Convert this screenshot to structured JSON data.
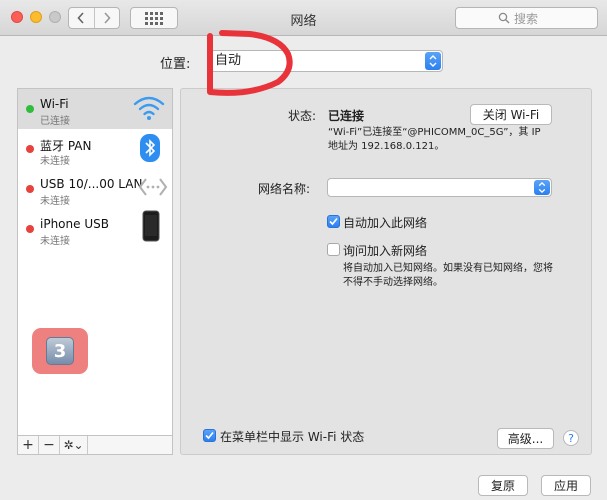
{
  "window": {
    "title": "网络",
    "search_placeholder": "搜索"
  },
  "location": {
    "label": "位置:",
    "value": "自动"
  },
  "sidebar": {
    "services": [
      {
        "name": "Wi-Fi",
        "status": "已连接",
        "dot": "green",
        "icon": "wifi-icon",
        "selected": true
      },
      {
        "name": "蓝牙 PAN",
        "status": "未连接",
        "dot": "red",
        "icon": "bluetooth-icon"
      },
      {
        "name": "USB 10/...00 LAN",
        "status": "未连接",
        "dot": "red",
        "icon": "ethernet-icon"
      },
      {
        "name": "iPhone USB",
        "status": "未连接",
        "dot": "red",
        "icon": "iphone-icon"
      }
    ],
    "tools": {
      "add": "+",
      "remove": "−",
      "gear": "✲⌄"
    }
  },
  "badge": {
    "number": "3"
  },
  "detail": {
    "status_label": "状态:",
    "status_value": "已连接",
    "turn_off_button": "关闭 Wi-Fi",
    "status_description": "“Wi-Fi”已连接至“@PHICOMM_0C_5G”，其 IP 地址为 192.168.0.121。",
    "network_name_label": "网络名称:",
    "network_name_value": "",
    "auto_join_label": "自动加入此网络",
    "auto_join_checked": true,
    "ask_join_label": "询问加入新网络",
    "ask_join_checked": false,
    "ask_join_hint": "将自动加入已知网络。如果没有已知网络，您将不得不手动选择网络。",
    "show_menubar_label": "在菜单栏中显示 Wi-Fi 状态",
    "show_menubar_checked": true,
    "advanced_button": "高级...",
    "help_button": "?"
  },
  "footer": {
    "revert_button": "复原",
    "apply_button": "应用"
  },
  "colors": {
    "accent": "#2b7ff0",
    "annotation": "#e8333a",
    "connected": "#2fbd3b",
    "disconnected": "#e8423d"
  }
}
